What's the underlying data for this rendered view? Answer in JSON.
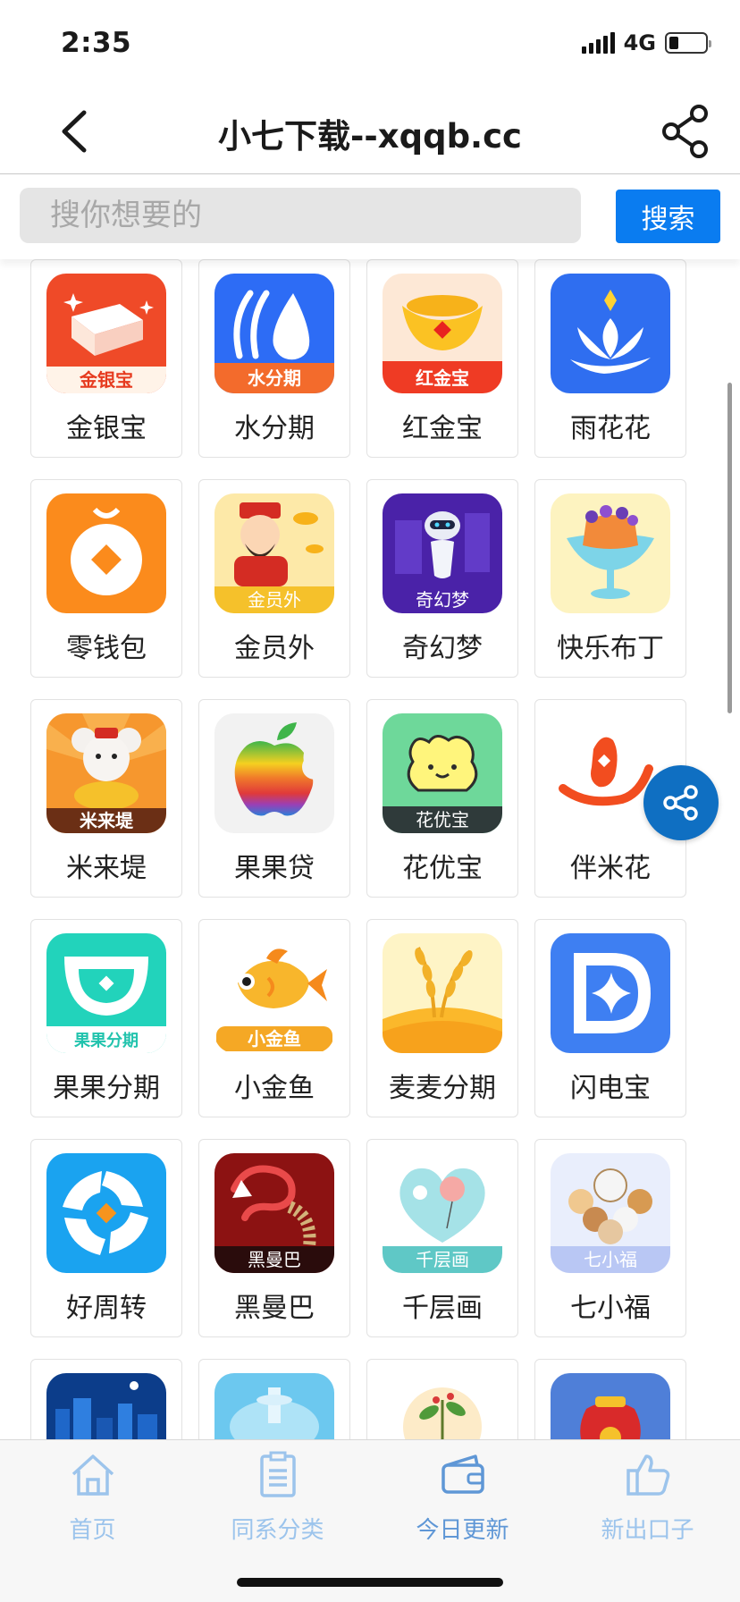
{
  "status_bar": {
    "time": "2:35",
    "network": "4G"
  },
  "nav": {
    "title": "小七下载--xqqb.cc"
  },
  "search": {
    "placeholder": "搜你想要的",
    "button_label": "搜索"
  },
  "apps": [
    {
      "name": "金银宝",
      "badge": "金银宝"
    },
    {
      "name": "水分期",
      "badge": "水分期"
    },
    {
      "name": "红金宝",
      "badge": "红金宝"
    },
    {
      "name": "雨花花",
      "badge": ""
    },
    {
      "name": "零钱包",
      "badge": ""
    },
    {
      "name": "金员外",
      "badge": "金员外"
    },
    {
      "name": "奇幻梦",
      "badge": "奇幻梦"
    },
    {
      "name": "快乐布丁",
      "badge": ""
    },
    {
      "name": "米来堤",
      "badge": "米来堤"
    },
    {
      "name": "果果贷",
      "badge": ""
    },
    {
      "name": "花优宝",
      "badge": "花优宝"
    },
    {
      "name": "伴米花",
      "badge": ""
    },
    {
      "name": "果果分期",
      "badge": "果果分期"
    },
    {
      "name": "小金鱼",
      "badge": "小金鱼"
    },
    {
      "name": "麦麦分期",
      "badge": ""
    },
    {
      "name": "闪电宝",
      "badge": ""
    },
    {
      "name": "好周转",
      "badge": ""
    },
    {
      "name": "黑曼巴",
      "badge": "黑曼巴"
    },
    {
      "name": "千层画",
      "badge": "千层画"
    },
    {
      "name": "七小福",
      "badge": "七小福"
    },
    {
      "name": "",
      "badge": ""
    },
    {
      "name": "",
      "badge": ""
    },
    {
      "name": "",
      "badge": ""
    },
    {
      "name": "",
      "badge": ""
    }
  ],
  "tabs": [
    {
      "label": "首页",
      "icon": "home-icon"
    },
    {
      "label": "同系分类",
      "icon": "clipboard-icon"
    },
    {
      "label": "今日更新",
      "icon": "wallet-icon",
      "active": true
    },
    {
      "label": "新出口子",
      "icon": "thumbs-up-icon"
    }
  ]
}
